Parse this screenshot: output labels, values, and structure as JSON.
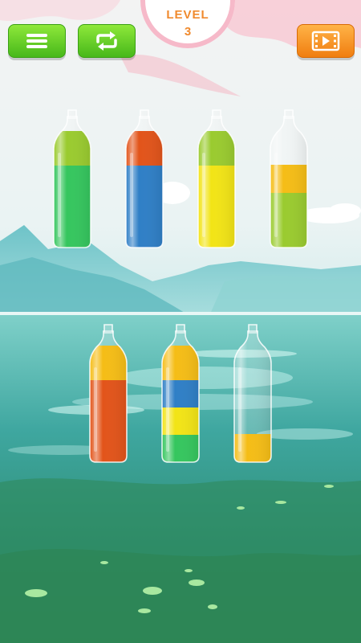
{
  "header": {
    "level_label": "LEVEL",
    "level_number": "3",
    "menu_icon": "hamburger-menu-icon",
    "restart_icon": "restart-arrows-icon",
    "video_icon": "video-play-icon"
  },
  "colors": {
    "green": "#35c65e",
    "lime": "#9acb2f",
    "orange": "#e2541a",
    "blue": "#2f7fc6",
    "yellow": "#f2e416",
    "gold": "#f5bd16"
  },
  "bottles": [
    {
      "id": "bottle-1",
      "row": 1,
      "layers": [
        "green",
        "green",
        "green",
        "lime"
      ]
    },
    {
      "id": "bottle-2",
      "row": 1,
      "layers": [
        "blue",
        "blue",
        "blue",
        "orange"
      ]
    },
    {
      "id": "bottle-3",
      "row": 1,
      "layers": [
        "yellow",
        "yellow",
        "yellow",
        "lime"
      ]
    },
    {
      "id": "bottle-4",
      "row": 1,
      "layers": [
        "lime",
        "lime",
        "gold",
        "empty"
      ]
    },
    {
      "id": "bottle-5",
      "row": 2,
      "layers": [
        "orange",
        "orange",
        "orange",
        "gold"
      ]
    },
    {
      "id": "bottle-6",
      "row": 2,
      "layers": [
        "green",
        "yellow",
        "blue",
        "gold"
      ]
    },
    {
      "id": "bottle-7",
      "row": 2,
      "layers": [
        "gold",
        "empty",
        "empty",
        "empty"
      ]
    }
  ]
}
